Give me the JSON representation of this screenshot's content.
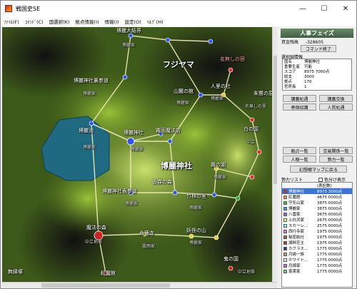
{
  "window": {
    "title": "戦国史SE"
  },
  "window_controls": {
    "minimize": "—",
    "maximize": "☐",
    "close": "✕"
  },
  "menu": [
    "ﾌｧｲﾙ(F)",
    "ｺﾏﾝﾄﾞ(C)",
    "国選択(K)",
    "拠点情報(I)",
    "情報(I)",
    "設定(O)",
    "ﾍﾙﾌﾟ(H)"
  ],
  "map": {
    "labels": [
      {
        "text": "博麗大結界",
        "kind": "normal"
      },
      {
        "text": "博麗家",
        "kind": "small"
      },
      {
        "text": "博麗神社",
        "kind": "big"
      },
      {
        "text": "フジヤマ",
        "kind": "big"
      },
      {
        "text": "博麗神社裏参道",
        "kind": "normal"
      },
      {
        "text": "博麗家",
        "kind": "small"
      },
      {
        "text": "博麗池",
        "kind": "normal"
      },
      {
        "text": "博麗家",
        "kind": "small"
      },
      {
        "text": "博麗神社",
        "kind": "normal"
      },
      {
        "text": "博麗家",
        "kind": "small"
      },
      {
        "text": "霧雨魔法店",
        "kind": "normal"
      },
      {
        "text": "博麗神社表参道",
        "kind": "normal"
      },
      {
        "text": "博麗家",
        "kind": "small"
      },
      {
        "text": "人里",
        "kind": "normal"
      },
      {
        "text": "博麗家",
        "kind": "small"
      },
      {
        "text": "人里の社",
        "kind": "normal"
      },
      {
        "text": "博麗家",
        "kind": "small"
      },
      {
        "text": "山麓の館",
        "kind": "normal"
      },
      {
        "text": "名無しの宿",
        "kind": "red"
      },
      {
        "text": "朱鷺の原",
        "kind": "normal"
      },
      {
        "text": "名無しの里",
        "kind": "small"
      },
      {
        "text": "白の国",
        "kind": "normal"
      },
      {
        "text": "中立",
        "kind": "small"
      },
      {
        "text": "香霖の店",
        "kind": "normal"
      },
      {
        "text": "香霖の森",
        "kind": "normal"
      },
      {
        "text": "霧の湖",
        "kind": "normal"
      },
      {
        "text": "博麗家",
        "kind": "small"
      },
      {
        "text": "竹林の里",
        "kind": "normal"
      },
      {
        "text": "博麗家",
        "kind": "small"
      },
      {
        "text": "魔法の森",
        "kind": "normal"
      },
      {
        "text": "中立地帯",
        "kind": "small"
      },
      {
        "text": "無縁塚",
        "kind": "normal"
      },
      {
        "text": "三途の川",
        "kind": "normal"
      },
      {
        "text": "命蓮寺",
        "kind": "normal"
      },
      {
        "text": "霧雨家",
        "kind": "small"
      },
      {
        "text": "妖怪の山",
        "kind": "normal"
      },
      {
        "text": "博麗家",
        "kind": "small"
      },
      {
        "text": "中立地帯",
        "kind": "small"
      },
      {
        "text": "紅魔館",
        "kind": "normal"
      },
      {
        "text": "鬼の国",
        "kind": "normal"
      },
      {
        "text": "太陽の畑",
        "kind": "normal"
      },
      {
        "text": "雲の上",
        "kind": "normal"
      }
    ]
  },
  "panel": {
    "header": "人事フェイズ",
    "funds_label": "資金残高",
    "funds_value": "-328605",
    "end_command": "コマンド終了",
    "selected_title": "選択国情報",
    "info": [
      {
        "k": "国名",
        "v": "博麗神社"
      },
      {
        "k": "重要生産",
        "v": "可能"
      },
      {
        "k": "スコア",
        "v": "8975 7000点"
      },
      {
        "k": "総支",
        "v": "3000"
      },
      {
        "k": "拠点",
        "v": "170"
      },
      {
        "k": "官房長",
        "v": "1"
      }
    ],
    "buttons": {
      "diplo_pact": "講義処遇",
      "diplo_exchange": "講義交換",
      "tribute": "寄宿招講",
      "hire": "人質処遇",
      "base_list": "拠点一覧",
      "trade_list": "交易関係一覧",
      "person_list": "人物一覧",
      "force_list": "勢力一覧",
      "back_map": "幻想郷マップに戻る"
    },
    "force_list_title": "勢力リスト",
    "color_toggle": "色分け表示",
    "list_headers": {
      "name": "",
      "score": "(表記数)"
    },
    "forces": [
      {
        "name": "博麗神社",
        "score": "8975 3000点",
        "color": "#e03030",
        "selected": true
      },
      {
        "name": "紅魔館",
        "score": "4675 0000点",
        "color": "#ff9933",
        "selected": false
      },
      {
        "name": "守矢山家",
        "score": "3875 0000点",
        "color": "#33cc33",
        "selected": false
      },
      {
        "name": "博麗家",
        "score": "3875 0000点",
        "color": "#3399ff",
        "selected": false
      },
      {
        "name": "八雲家",
        "score": "3675 0000点",
        "color": "#9966cc",
        "selected": false
      },
      {
        "name": "上白沢家",
        "score": "2675 0000点",
        "color": "#ffff66",
        "selected": false
      },
      {
        "name": "スカーレ...",
        "score": "2575 0000点",
        "color": "#66ffff",
        "selected": false
      },
      {
        "name": "西行寺家",
        "score": "1975 0000点",
        "color": "#ff66cc",
        "selected": false
      },
      {
        "name": "秘密結社",
        "score": "1975 0000点",
        "color": "#996633",
        "selected": false
      },
      {
        "name": "湖畔荘主",
        "score": "1975 0000点",
        "color": "#cc3333",
        "selected": false
      },
      {
        "name": "カクラス...",
        "score": "1775 0000点",
        "color": "#3333cc",
        "selected": false
      },
      {
        "name": "月嶋一族",
        "score": "1775 0000点",
        "color": "#cc9966",
        "selected": false
      },
      {
        "name": "ホワイト...",
        "score": "1775 0000点",
        "color": "#ffffff",
        "selected": false
      },
      {
        "name": "月綺家",
        "score": "1775 0000点",
        "color": "#cc66ff",
        "selected": false
      },
      {
        "name": "蓬莱家",
        "score": "1775 0000点",
        "color": "#66cc99",
        "selected": false
      }
    ]
  }
}
